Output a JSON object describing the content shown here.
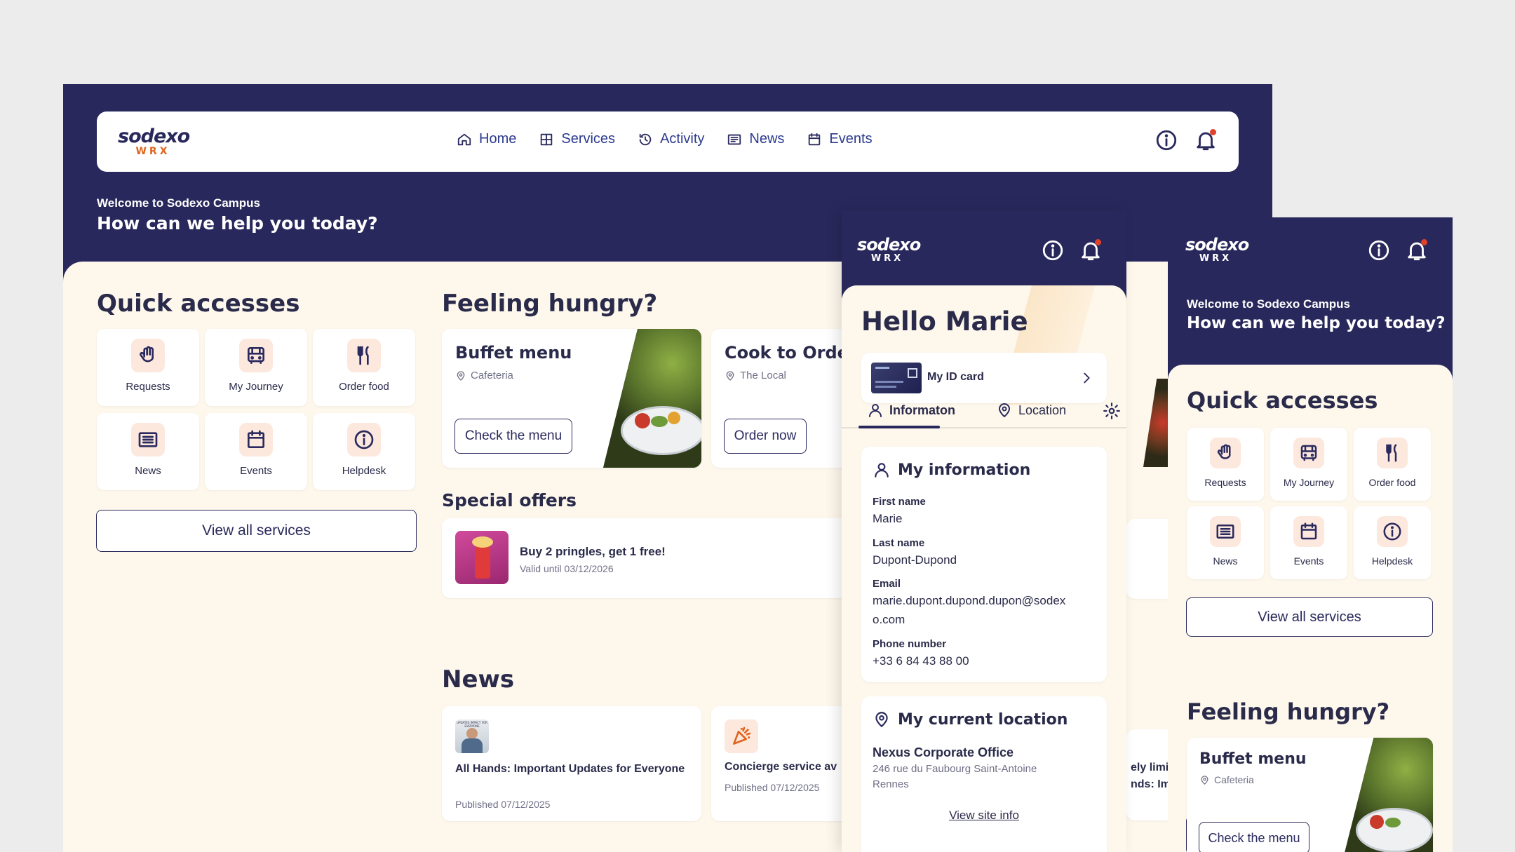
{
  "desktop": {
    "logo": {
      "brand": "sodexo",
      "sub": "WRX"
    },
    "nav": [
      {
        "label": "Home",
        "icon": "home-icon"
      },
      {
        "label": "Services",
        "icon": "grid-icon"
      },
      {
        "label": "Activity",
        "icon": "history-icon"
      },
      {
        "label": "News",
        "icon": "newspaper-icon"
      },
      {
        "label": "Events",
        "icon": "calendar-icon"
      }
    ],
    "welcome_small": "Welcome to Sodexo Campus",
    "welcome_big": "How can we help you today?",
    "quick_title": "Quick accesses",
    "quick": [
      {
        "label": "Requests",
        "icon": "hand-icon"
      },
      {
        "label": "My Journey",
        "icon": "bus-icon"
      },
      {
        "label": "Order food",
        "icon": "fork-knife-icon"
      },
      {
        "label": "News",
        "icon": "newspaper-icon"
      },
      {
        "label": "Events",
        "icon": "calendar-icon"
      },
      {
        "label": "Helpdesk",
        "icon": "info-icon"
      }
    ],
    "view_all": "View all services",
    "hungry_title": "Feeling hungry?",
    "food_cards": [
      {
        "title": "Buffet menu",
        "place": "Cafeteria",
        "button": "Check the menu"
      },
      {
        "title": "Cook to Order",
        "place": "The Local",
        "button": "Order now"
      }
    ],
    "offers_title": "Special offers",
    "offer": {
      "title": "Buy 2 pringles, get 1 free!",
      "valid": "Valid until 03/12/2026"
    },
    "news_title": "News",
    "news": [
      {
        "title": "All Hands: Important Updates for Everyone",
        "date": "Published 07/12/2025",
        "thumb_text": "UPDATES IMPACT FOR EVERYONE"
      },
      {
        "title": "Concierge service av",
        "date": "Published 07/12/2025"
      },
      {
        "title": "ely limit",
        "title2": "nds: Imp"
      }
    ]
  },
  "phone1": {
    "logo": {
      "brand": "sodexo",
      "sub": "WRX"
    },
    "greeting": "Hello Marie",
    "id_card": "My ID card",
    "tabs": [
      "Informaton",
      "Location"
    ],
    "info_title": "My information",
    "fields": [
      {
        "label": "First name",
        "value": "Marie"
      },
      {
        "label": "Last name",
        "value": "Dupont-Dupond"
      },
      {
        "label": "Email",
        "value": "marie.dupont.dupond.dupon@sodex",
        "value2": "o.com"
      },
      {
        "label": "Phone number",
        "value": "+33 6 84 43 88 00"
      }
    ],
    "location_title": "My current location",
    "office": "Nexus Corporate Office",
    "address1": "246 rue du Faubourg Saint-Antoine",
    "address2": "Rennes",
    "site_link": "View site info"
  },
  "phone2": {
    "logo": {
      "brand": "sodexo",
      "sub": "WRX"
    },
    "welcome_small": "Welcome to Sodexo Campus",
    "welcome_big": "How can we help you today?",
    "quick_title": "Quick accesses",
    "quick": [
      {
        "label": "Requests"
      },
      {
        "label": "My Journey"
      },
      {
        "label": "Order food"
      },
      {
        "label": "News"
      },
      {
        "label": "Events"
      },
      {
        "label": "Helpdesk"
      }
    ],
    "view_all": "View all services",
    "hungry_title": "Feeling hungry?",
    "food": {
      "title": "Buffet menu",
      "place": "Cafeteria",
      "button": "Check the menu"
    }
  },
  "colors": {
    "navy": "#28285c",
    "cream": "#fdf7ec",
    "accent_orange": "#e0651e",
    "icon_bg": "#fde8de",
    "notif_dot": "#e0412a",
    "link_blue": "#2b3a8f"
  }
}
